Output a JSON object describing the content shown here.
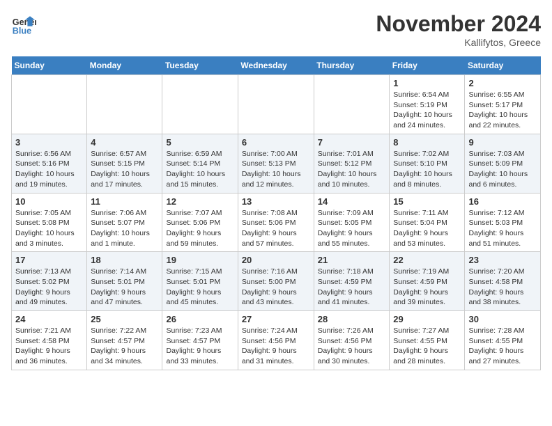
{
  "logo": {
    "line1": "General",
    "line2": "Blue"
  },
  "title": "November 2024",
  "subtitle": "Kallifytos, Greece",
  "weekdays": [
    "Sunday",
    "Monday",
    "Tuesday",
    "Wednesday",
    "Thursday",
    "Friday",
    "Saturday"
  ],
  "weeks": [
    [
      {
        "day": "",
        "info": ""
      },
      {
        "day": "",
        "info": ""
      },
      {
        "day": "",
        "info": ""
      },
      {
        "day": "",
        "info": ""
      },
      {
        "day": "",
        "info": ""
      },
      {
        "day": "1",
        "info": "Sunrise: 6:54 AM\nSunset: 5:19 PM\nDaylight: 10 hours and 24 minutes."
      },
      {
        "day": "2",
        "info": "Sunrise: 6:55 AM\nSunset: 5:17 PM\nDaylight: 10 hours and 22 minutes."
      }
    ],
    [
      {
        "day": "3",
        "info": "Sunrise: 6:56 AM\nSunset: 5:16 PM\nDaylight: 10 hours and 19 minutes."
      },
      {
        "day": "4",
        "info": "Sunrise: 6:57 AM\nSunset: 5:15 PM\nDaylight: 10 hours and 17 minutes."
      },
      {
        "day": "5",
        "info": "Sunrise: 6:59 AM\nSunset: 5:14 PM\nDaylight: 10 hours and 15 minutes."
      },
      {
        "day": "6",
        "info": "Sunrise: 7:00 AM\nSunset: 5:13 PM\nDaylight: 10 hours and 12 minutes."
      },
      {
        "day": "7",
        "info": "Sunrise: 7:01 AM\nSunset: 5:12 PM\nDaylight: 10 hours and 10 minutes."
      },
      {
        "day": "8",
        "info": "Sunrise: 7:02 AM\nSunset: 5:10 PM\nDaylight: 10 hours and 8 minutes."
      },
      {
        "day": "9",
        "info": "Sunrise: 7:03 AM\nSunset: 5:09 PM\nDaylight: 10 hours and 6 minutes."
      }
    ],
    [
      {
        "day": "10",
        "info": "Sunrise: 7:05 AM\nSunset: 5:08 PM\nDaylight: 10 hours and 3 minutes."
      },
      {
        "day": "11",
        "info": "Sunrise: 7:06 AM\nSunset: 5:07 PM\nDaylight: 10 hours and 1 minute."
      },
      {
        "day": "12",
        "info": "Sunrise: 7:07 AM\nSunset: 5:06 PM\nDaylight: 9 hours and 59 minutes."
      },
      {
        "day": "13",
        "info": "Sunrise: 7:08 AM\nSunset: 5:06 PM\nDaylight: 9 hours and 57 minutes."
      },
      {
        "day": "14",
        "info": "Sunrise: 7:09 AM\nSunset: 5:05 PM\nDaylight: 9 hours and 55 minutes."
      },
      {
        "day": "15",
        "info": "Sunrise: 7:11 AM\nSunset: 5:04 PM\nDaylight: 9 hours and 53 minutes."
      },
      {
        "day": "16",
        "info": "Sunrise: 7:12 AM\nSunset: 5:03 PM\nDaylight: 9 hours and 51 minutes."
      }
    ],
    [
      {
        "day": "17",
        "info": "Sunrise: 7:13 AM\nSunset: 5:02 PM\nDaylight: 9 hours and 49 minutes."
      },
      {
        "day": "18",
        "info": "Sunrise: 7:14 AM\nSunset: 5:01 PM\nDaylight: 9 hours and 47 minutes."
      },
      {
        "day": "19",
        "info": "Sunrise: 7:15 AM\nSunset: 5:01 PM\nDaylight: 9 hours and 45 minutes."
      },
      {
        "day": "20",
        "info": "Sunrise: 7:16 AM\nSunset: 5:00 PM\nDaylight: 9 hours and 43 minutes."
      },
      {
        "day": "21",
        "info": "Sunrise: 7:18 AM\nSunset: 4:59 PM\nDaylight: 9 hours and 41 minutes."
      },
      {
        "day": "22",
        "info": "Sunrise: 7:19 AM\nSunset: 4:59 PM\nDaylight: 9 hours and 39 minutes."
      },
      {
        "day": "23",
        "info": "Sunrise: 7:20 AM\nSunset: 4:58 PM\nDaylight: 9 hours and 38 minutes."
      }
    ],
    [
      {
        "day": "24",
        "info": "Sunrise: 7:21 AM\nSunset: 4:58 PM\nDaylight: 9 hours and 36 minutes."
      },
      {
        "day": "25",
        "info": "Sunrise: 7:22 AM\nSunset: 4:57 PM\nDaylight: 9 hours and 34 minutes."
      },
      {
        "day": "26",
        "info": "Sunrise: 7:23 AM\nSunset: 4:57 PM\nDaylight: 9 hours and 33 minutes."
      },
      {
        "day": "27",
        "info": "Sunrise: 7:24 AM\nSunset: 4:56 PM\nDaylight: 9 hours and 31 minutes."
      },
      {
        "day": "28",
        "info": "Sunrise: 7:26 AM\nSunset: 4:56 PM\nDaylight: 9 hours and 30 minutes."
      },
      {
        "day": "29",
        "info": "Sunrise: 7:27 AM\nSunset: 4:55 PM\nDaylight: 9 hours and 28 minutes."
      },
      {
        "day": "30",
        "info": "Sunrise: 7:28 AM\nSunset: 4:55 PM\nDaylight: 9 hours and 27 minutes."
      }
    ]
  ]
}
